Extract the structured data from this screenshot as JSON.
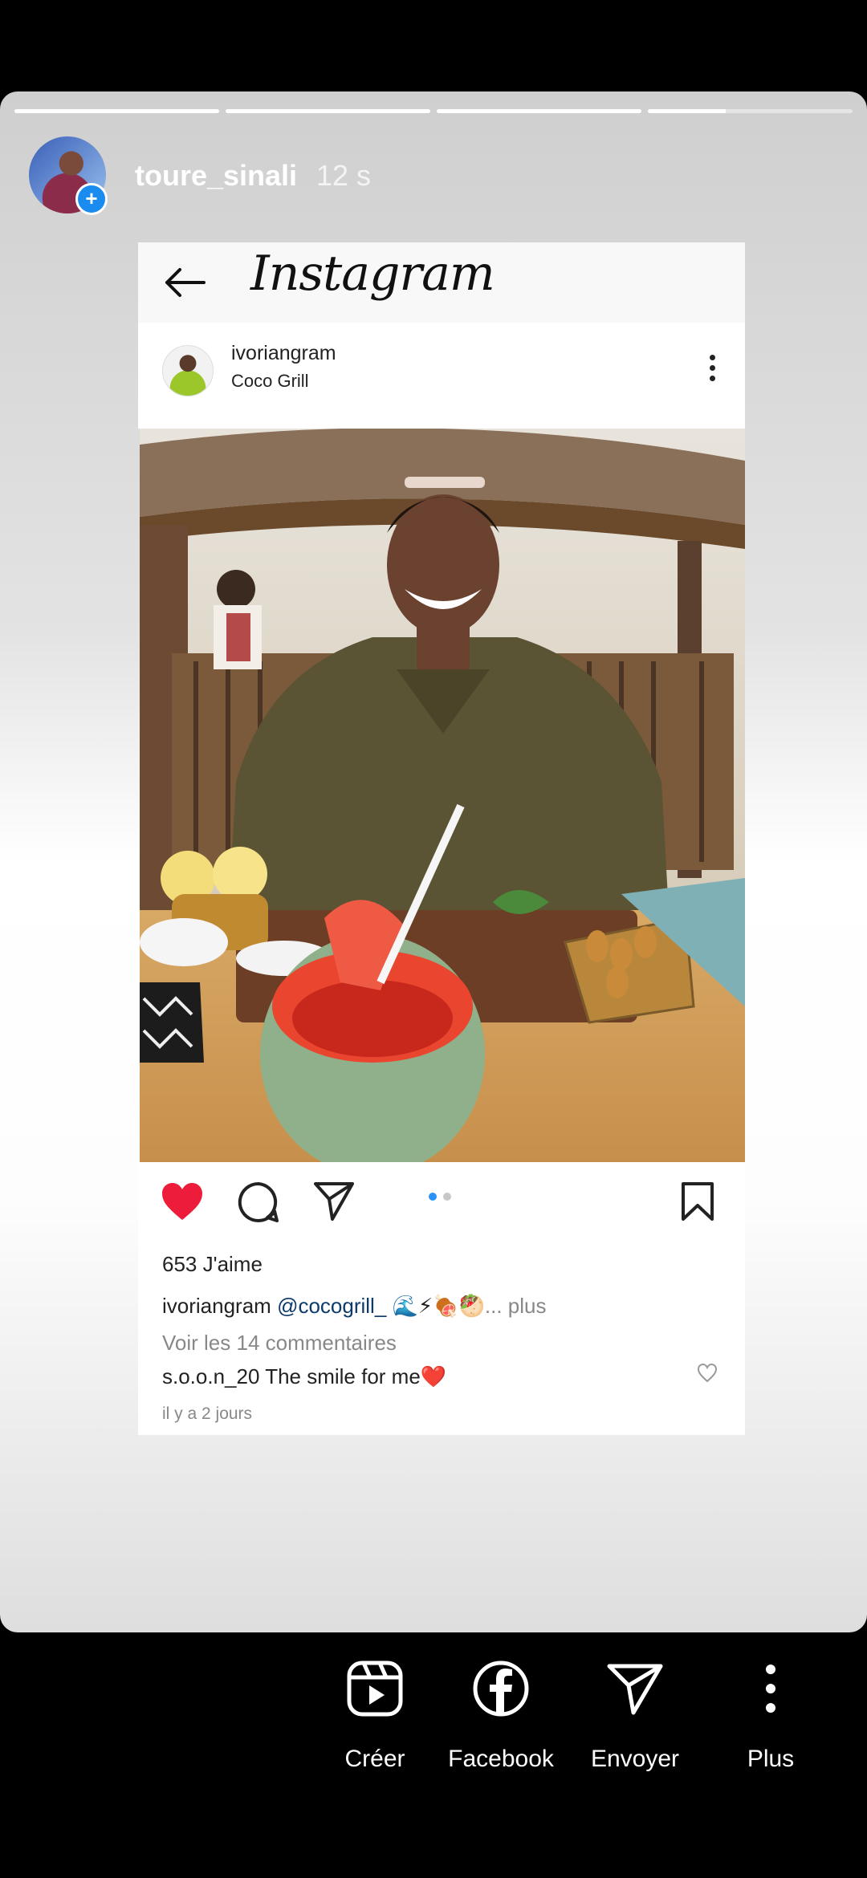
{
  "story": {
    "username": "toure_sinali",
    "time": "12 s",
    "progress": [
      1,
      1,
      1,
      0.38
    ]
  },
  "screenshot_header": {
    "title": "Instagram"
  },
  "post": {
    "username": "ivoriangram",
    "location": "Coco Grill",
    "likes": "653 J'aime",
    "caption_user": "ivoriangram",
    "caption_mention": "@cocogrill_",
    "caption_emoji": " 🌊⚡🍖🥙",
    "caption_more": "... plus",
    "view_comments": "Voir les 14 commentaires",
    "comment_user": "s.o.o.n_20",
    "comment_text": " The smile for me❤️",
    "time_ago": "il y a 2 jours",
    "carousel_count": 2,
    "carousel_index": 0,
    "liked": true
  },
  "bottom_actions": [
    {
      "label": "Créer",
      "icon": "reels-icon"
    },
    {
      "label": "Facebook",
      "icon": "facebook-icon"
    },
    {
      "label": "Envoyer",
      "icon": "send-icon"
    },
    {
      "label": "Plus",
      "icon": "more-vertical-icon"
    }
  ],
  "colors": {
    "like_red": "#ed1c3a",
    "accent_blue": "#2b93f5",
    "mention_blue": "#0b3a6b"
  }
}
